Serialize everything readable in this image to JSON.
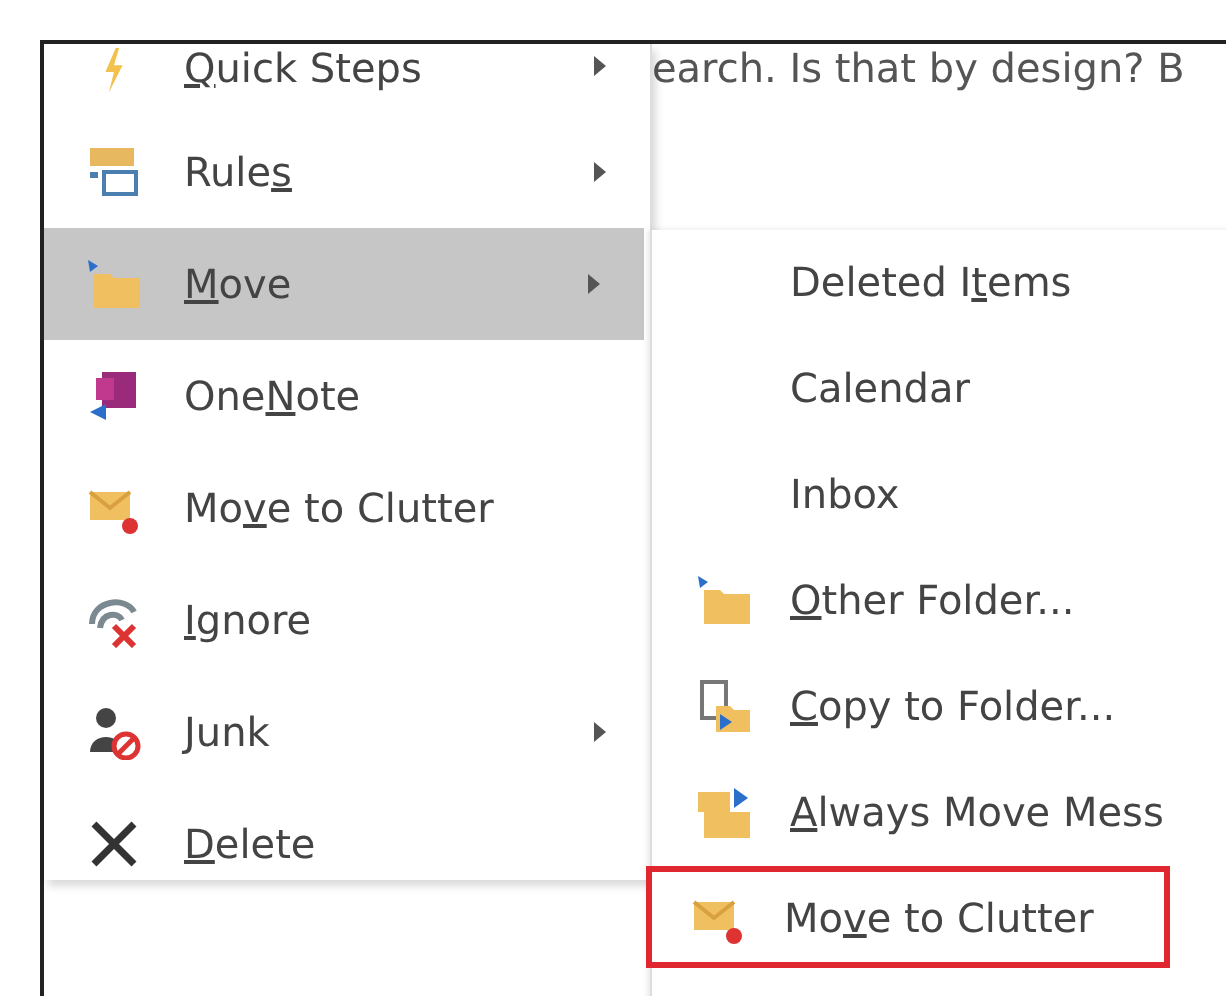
{
  "background_text": "earch. Is that by design? B",
  "menu": {
    "items": [
      {
        "kind": "bolt",
        "key": "Q",
        "post": "uick Steps",
        "submenu": true,
        "selected": false
      },
      {
        "kind": "rules",
        "pre": "Rule",
        "key": "s",
        "submenu": true,
        "selected": false
      },
      {
        "kind": "folder-move",
        "key": "M",
        "post": "ove",
        "submenu": true,
        "selected": true
      },
      {
        "kind": "onenote",
        "pre": "One",
        "key": "N",
        "post": "ote",
        "submenu": false,
        "selected": false
      },
      {
        "kind": "clutter",
        "pre": "Mo",
        "key": "v",
        "post": "e to Clutter",
        "submenu": false,
        "selected": false
      },
      {
        "kind": "ignore",
        "key": "I",
        "post": "gnore",
        "submenu": false,
        "selected": false
      },
      {
        "kind": "junk",
        "key": "J",
        "post": "unk",
        "submenu": true,
        "selected": false
      },
      {
        "kind": "delete",
        "key": "D",
        "post": "elete",
        "submenu": false,
        "selected": false
      }
    ]
  },
  "submenu": {
    "items": [
      {
        "kind": "plain",
        "pre": "Deleted I",
        "key": "t",
        "post": "ems",
        "outlined": false
      },
      {
        "kind": "plain",
        "post": "Calendar",
        "outlined": false
      },
      {
        "kind": "plain",
        "post": "Inbox",
        "outlined": false
      },
      {
        "kind": "folder-move",
        "key": "O",
        "post": "ther Folder...",
        "outlined": false
      },
      {
        "kind": "copy",
        "key": "C",
        "post": "opy to Folder...",
        "outlined": false
      },
      {
        "kind": "always-move",
        "key": "A",
        "post": "lways Move Mess",
        "outlined": false
      },
      {
        "kind": "clutter",
        "pre": "Mo",
        "key": "v",
        "post": "e to Clutter",
        "outlined": true
      }
    ]
  }
}
